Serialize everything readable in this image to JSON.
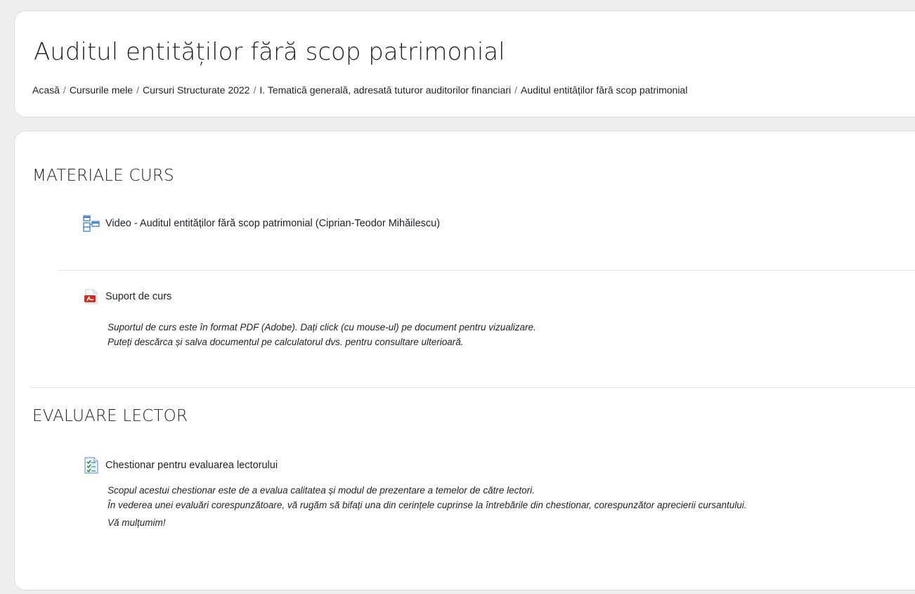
{
  "page": {
    "title": "Auditul entităților fără scop patrimonial"
  },
  "breadcrumb": {
    "items": [
      "Acasă",
      "Cursurile mele",
      "Cursuri Structurate 2022",
      "I. Tematică generală, adresată tuturor auditorilor financiari",
      "Auditul entităților fără scop patrimonial"
    ],
    "separator": "/"
  },
  "sections": [
    {
      "title": "MATERIALE CURS",
      "activities": [
        {
          "icon": "page-icon",
          "label": "Video - Auditul entităților fără scop patrimonial (Ciprian-Teodor Mihăilescu)"
        },
        {
          "icon": "pdf-icon",
          "label": "Suport de curs",
          "description": [
            "Suportul de curs este în format PDF (Adobe). Dați click (cu mouse-ul) pe document pentru vizualizare.",
            "Puteți descărca și salva documentul pe calculatorul dvs. pentru consultare ulterioară."
          ]
        }
      ]
    },
    {
      "title": "EVALUARE LECTOR",
      "activities": [
        {
          "icon": "questionnaire-icon",
          "label": "Chestionar pentru evaluarea lectorului",
          "description": [
            "Scopul acestui chestionar este de a evalua calitatea și modul de prezentare a temelor de către lectori.",
            "În vederea unei evaluări corespunzătoare, vă rugăm să bifați una din cerințele cuprinse la întrebările din chestionar, corespunzător aprecierii cursantului.",
            "Vă mulțumim!"
          ]
        }
      ]
    }
  ],
  "colors": {
    "text": "#1d2125",
    "card": "#ffffff",
    "background": "#eeeeee",
    "pdf_red": "#d42b1e",
    "icon_blue": "#3d7dc9"
  }
}
